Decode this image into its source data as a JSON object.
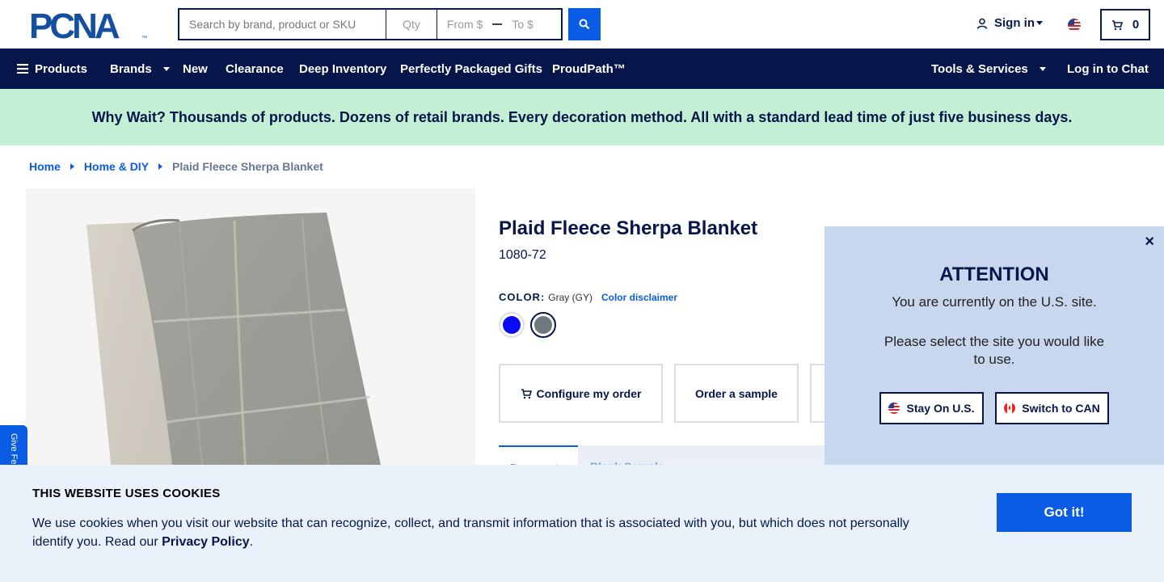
{
  "header": {
    "logo_text": "PCNA",
    "search_placeholder": "Search by brand, product or SKU",
    "qty_placeholder": "Qty",
    "price_from_placeholder": "From $",
    "price_to_placeholder": "To $",
    "signin_label": "Sign in",
    "cart_count": "0"
  },
  "nav": {
    "products": "Products",
    "brands": "Brands",
    "new": "New",
    "clearance": "Clearance",
    "deep_inventory": "Deep Inventory",
    "gifts": "Perfectly Packaged Gifts",
    "proudpath": "ProudPath™",
    "tools": "Tools & Services",
    "chat": "Log in to Chat"
  },
  "banner": {
    "text": "Why Wait? Thousands of products. Dozens of retail brands. Every decoration method. All with a standard lead time of just five business days."
  },
  "breadcrumb": {
    "home": "Home",
    "category": "Home & DIY",
    "current": "Plaid Fleece Sherpa Blanket"
  },
  "product": {
    "title": "Plaid Fleece Sherpa Blanket",
    "sku": "1080-72",
    "color_label": "COLOR:",
    "color_value": "Gray (GY)",
    "color_disclaimer": "Color disclaimer",
    "swatches": [
      {
        "name": "Blue",
        "color": "#0a0af5"
      },
      {
        "name": "Gray",
        "color": "#6e7880"
      }
    ],
    "configure_label": "Configure my order",
    "sample_label": "Order a sample",
    "tab_active": "Does not",
    "tab_inactive": "Blank Sample"
  },
  "feedback": {
    "label": "Give Feedback"
  },
  "attention": {
    "title": "ATTENTION",
    "message": "You are currently on the U.S. site.",
    "message2": "Please select the site you would like to use.",
    "stay_label": "Stay On U.S.",
    "switch_label": "Switch to CAN"
  },
  "cookie": {
    "title": "THIS WEBSITE USES COOKIES",
    "text": "We use cookies when you visit our website that can recognize, collect, and transmit information that is associated with you, but which does not personally identify you. Read our ",
    "link": "Privacy Policy",
    "end": ".",
    "button": "Got it!"
  },
  "colors": {
    "navy": "#07164a",
    "accent_blue": "#0a5ce5",
    "banner_green": "#c3efd5",
    "modal_bg": "#c8d7ee",
    "cookie_bg": "#e9f1fb"
  }
}
